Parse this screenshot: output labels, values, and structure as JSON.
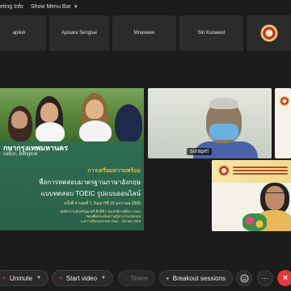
{
  "topbar": {
    "meeting_info": "eting Info",
    "show_menu_bar": "Show Menu Bar"
  },
  "participants_strip": [
    {
      "name": "apiluk"
    },
    {
      "name": "Apisara Sengsai"
    },
    {
      "name": "Mnaswee"
    },
    {
      "name": "Siri Kunawut"
    }
  ],
  "shared_screen": {
    "school_name": "กษากรุงเทพมหานคร",
    "school_sub": "cation, Bangkok",
    "line1": "การเตรียมความพร้อม",
    "line2": "พื่อการทดสอบมาตรฐานภาษาอังกฤษ",
    "line3": "แบบทดสอบ TOEIC รูปแบบออนไลน์",
    "line4": "ครั้งที่ 4 กลุ่มที่ 1 วันเสาร์ที่ 15 มกราคม 2565",
    "small1": "นักศึกษาระดับปริญญาตรี ชั้นปีที่ 3 ประจำปีการศึกษา 2564",
    "small2": "สอบเพื่อประเมินความรู้ทางภาษาอังกฤษ",
    "small3": "ระหว่างเดือนมกราคม 2564 – มีนาคม 2565"
  },
  "videos": {
    "main_name": "surapel"
  },
  "toolbar": {
    "unmute": "Unmute",
    "start_video": "Start video",
    "share": "Share",
    "breakout": "Breakout sessions"
  },
  "icons": {
    "mic": "microphone-muted-icon",
    "video": "video-camera-icon",
    "share": "share-icon",
    "breakout": "breakout-icon",
    "reactions": "emoji-icon",
    "more": "more-icon",
    "leave": "close-icon"
  },
  "colors": {
    "leave": "#e5383b",
    "accent_orange": "#f2b134"
  }
}
